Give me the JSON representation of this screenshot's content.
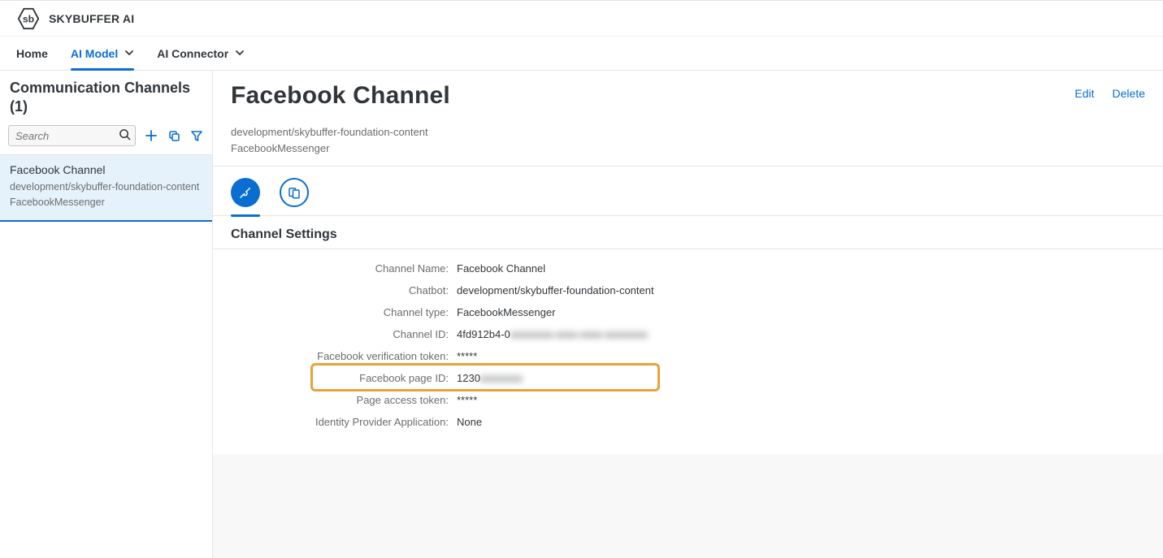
{
  "app": {
    "title": "SKYBUFFER AI",
    "logo_label": "sb"
  },
  "nav": {
    "items": [
      {
        "label": "Home",
        "has_dropdown": false,
        "active": false
      },
      {
        "label": "AI Model",
        "has_dropdown": true,
        "active": true
      },
      {
        "label": "AI Connector",
        "has_dropdown": true,
        "active": false
      }
    ]
  },
  "sidebar": {
    "title": "Communication Channels (1)",
    "search_placeholder": "Search",
    "items": [
      {
        "title": "Facebook Channel",
        "sub1": "development/skybuffer-foundation-content",
        "sub2": "FacebookMessenger"
      }
    ]
  },
  "page": {
    "title": "Facebook Channel",
    "sub1": "development/skybuffer-foundation-content",
    "sub2": "FacebookMessenger",
    "actions": {
      "edit": "Edit",
      "delete": "Delete"
    },
    "section_title": "Channel Settings",
    "fields": {
      "channel_name": {
        "label": "Channel Name:",
        "value": "Facebook Channel"
      },
      "chatbot": {
        "label": "Chatbot:",
        "value": "development/skybuffer-foundation-content"
      },
      "channel_type": {
        "label": "Channel type:",
        "value": "FacebookMessenger"
      },
      "channel_id": {
        "label": "Channel ID:",
        "value_visible": "4fd912b4-0",
        "value_blurred": "xxxxxxxx-xxxx-xxxx-xxxxxxxx"
      },
      "fb_verification_token": {
        "label": "Facebook verification token:",
        "value": "*****"
      },
      "fb_page_id": {
        "label": "Facebook page ID:",
        "value_visible": "1230",
        "value_blurred": "xxxxxxxx"
      },
      "page_access_token": {
        "label": "Page access token:",
        "value": "*****"
      },
      "idp_app": {
        "label": "Identity Provider Application:",
        "value": "None"
      }
    }
  }
}
